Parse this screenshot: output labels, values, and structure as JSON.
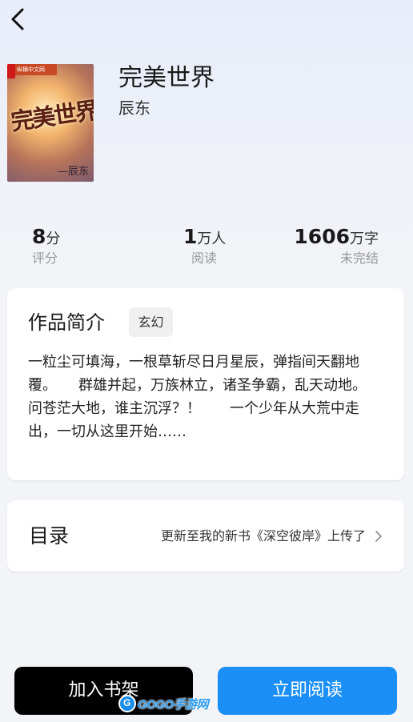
{
  "header": {
    "back_icon": "chevron-left-icon"
  },
  "book": {
    "title": "完美世界",
    "author": "辰东",
    "cover": {
      "title_text": "完美世界",
      "author_text": "—辰东",
      "publisher_text": "纵横中文网"
    }
  },
  "stats": {
    "score": {
      "value": "8",
      "unit": "分",
      "label": "评分"
    },
    "readers": {
      "value": "1",
      "unit": "万人",
      "label": "阅读"
    },
    "words": {
      "value": "1606",
      "unit": "万字",
      "label": "未完结"
    }
  },
  "intro": {
    "heading": "作品简介",
    "tag": "玄幻",
    "text": "一粒尘可填海，一根草斩尽日月星辰，弹指间天翻地覆。　　群雄并起，万族林立，诸圣争霸，乱天动地。问苍茫大地，谁主沉浮？！　　一个少年从大荒中走出，一切从这里开始……"
  },
  "toc": {
    "heading": "目录",
    "latest_chapter": "更新至我的新书《深空彼岸》上传了",
    "chevron_icon": "chevron-right-icon"
  },
  "actions": {
    "add_shelf": "加入书架",
    "read_now": "立即阅读"
  },
  "watermark": {
    "text": "GOGO手游网"
  },
  "colors": {
    "primary": "#1b8ff7",
    "dark_button": "#000000"
  }
}
